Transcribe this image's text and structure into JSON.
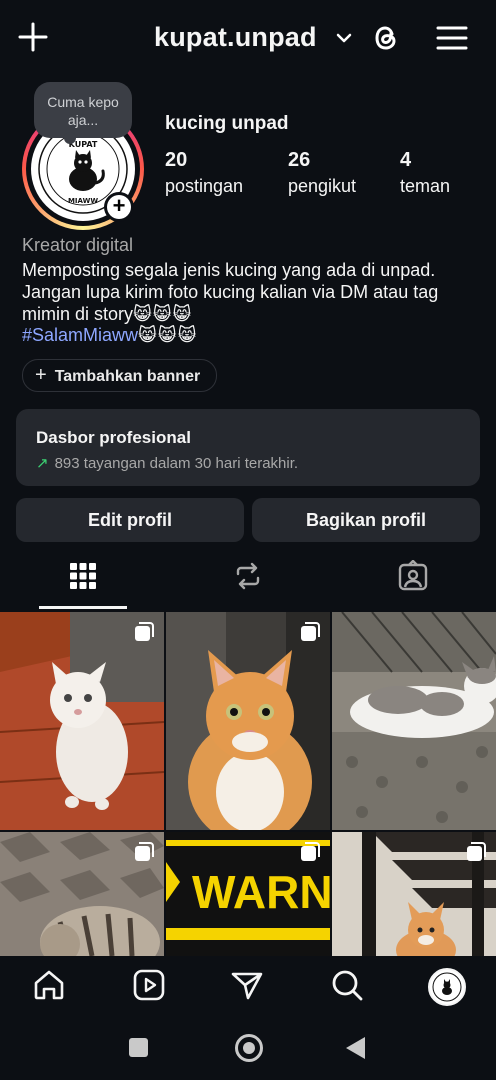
{
  "header": {
    "username": "kupat.unpad",
    "icons": [
      "plus-icon",
      "chevron-down-icon",
      "threads-icon",
      "menu-icon"
    ]
  },
  "note": {
    "text": "Cuma kepo aja..."
  },
  "profile": {
    "display_name": "kucing unpad",
    "stats": [
      {
        "value": "20",
        "label": "postingan"
      },
      {
        "value": "26",
        "label": "pengikut"
      },
      {
        "value": "4",
        "label": "teman"
      }
    ],
    "avatar_text_top": "KUPAT",
    "avatar_text_bottom": "MIAWW",
    "category": "Kreator digital",
    "bio_text": "Memposting segala jenis kucing yang ada di unpad. Jangan lupa kirim foto kucing kalian via DM atau tag mimin di story",
    "bio_emoji": "😸😸😸",
    "hashtag": "#SalamMiaww",
    "hashtag_emoji": "😸😸😸",
    "banner_button": "Tambahkan banner"
  },
  "dashboard": {
    "title": "Dasbor profesional",
    "subtitle": "893 tayangan dalam 30 hari terakhir."
  },
  "actions": {
    "edit": "Edit profil",
    "share": "Bagikan profil"
  },
  "tabs": [
    "grid-icon",
    "reels-repost-icon",
    "tagged-icon"
  ],
  "posts": [
    {
      "alt": "white cat on red tiles",
      "multi": true
    },
    {
      "alt": "orange tabby cat",
      "multi": true
    },
    {
      "alt": "white and grey cat lying",
      "multi": false
    },
    {
      "alt": "tabby cat on pavement",
      "multi": true
    },
    {
      "alt": "warning sign",
      "multi": true,
      "text": "WARNIN"
    },
    {
      "alt": "orange cat near stairs",
      "multi": true
    }
  ],
  "bottom_nav": [
    "home-icon",
    "reels-icon",
    "send-icon",
    "search-icon",
    "profile-avatar"
  ],
  "colors": {
    "background": "#0c0f14",
    "card": "#25282e",
    "hashtag": "#8ea7ff",
    "trend": "#3cd173"
  }
}
